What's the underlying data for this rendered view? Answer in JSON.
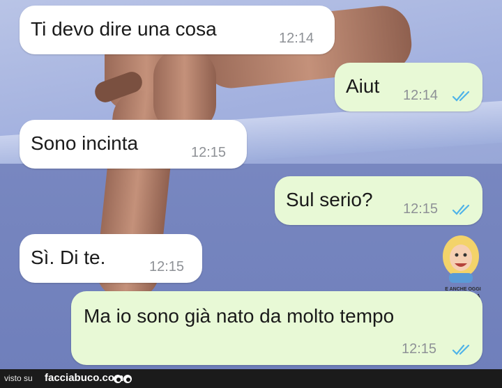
{
  "colors": {
    "incoming_bubble": "#ffffff",
    "outgoing_bubble": "#e8f9d6",
    "read_ticks": "#4fb3e8",
    "timestamp": "#8e9196"
  },
  "messages": [
    {
      "direction": "incoming",
      "text": "Ti devo dire una cosa",
      "time": "12:14"
    },
    {
      "direction": "outgoing",
      "text": "Aiut",
      "time": "12:14",
      "status": "read"
    },
    {
      "direction": "incoming",
      "text": "Sono incinta",
      "time": "12:15"
    },
    {
      "direction": "outgoing",
      "text": "Sul serio?",
      "time": "12:15",
      "status": "read"
    },
    {
      "direction": "incoming",
      "text": "Sì. Di te.",
      "time": "12:15"
    },
    {
      "direction": "outgoing",
      "text": "Ma io sono già nato da molto tempo",
      "time": "12:15",
      "status": "read"
    }
  ],
  "watermark": {
    "line1": "E ANCHE OGGI",
    "line2": "SI RIMORCHIA DOMANI"
  },
  "footer": {
    "prefix": "visto su",
    "site": "facciabuco.com",
    "icon": "googly-eyes-icon"
  }
}
